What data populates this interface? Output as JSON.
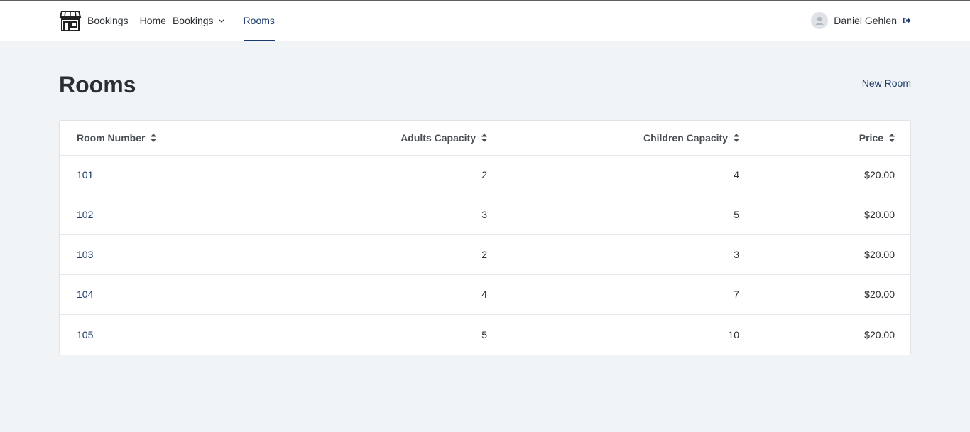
{
  "nav": {
    "brand": {
      "name": "Bookings",
      "icon": "storefront-icon"
    },
    "items": [
      {
        "label": "Home"
      },
      {
        "label": "Bookings",
        "dropdown": true
      },
      {
        "label": "Rooms",
        "active": true
      }
    ],
    "user": {
      "name": "Daniel Gehlen",
      "icon": "logout-icon"
    }
  },
  "page": {
    "title": "Rooms",
    "new_button": "New Room"
  },
  "table": {
    "columns": [
      {
        "label": "Room Number",
        "sortable": true
      },
      {
        "label": "Adults Capacity",
        "sortable": true
      },
      {
        "label": "Children Capacity",
        "sortable": true
      },
      {
        "label": "Price",
        "sortable": true
      }
    ],
    "rows": [
      {
        "room": "101",
        "adults": "2",
        "children": "4",
        "price": "$20.00"
      },
      {
        "room": "102",
        "adults": "3",
        "children": "5",
        "price": "$20.00"
      },
      {
        "room": "103",
        "adults": "2",
        "children": "3",
        "price": "$20.00"
      },
      {
        "room": "104",
        "adults": "4",
        "children": "7",
        "price": "$20.00"
      },
      {
        "room": "105",
        "adults": "5",
        "children": "10",
        "price": "$20.00"
      }
    ]
  },
  "colors": {
    "accent": "#1b3a6b",
    "background": "#f1f4f7",
    "text": "#2b2f33"
  }
}
